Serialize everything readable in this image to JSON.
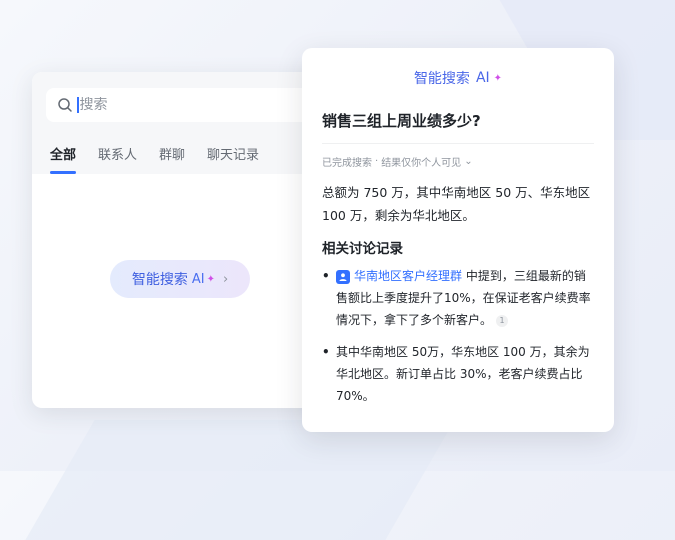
{
  "search_panel": {
    "placeholder": "搜索",
    "tabs": [
      {
        "label": "全部",
        "active": true
      },
      {
        "label": "联系人",
        "active": false
      },
      {
        "label": "群聊",
        "active": false
      },
      {
        "label": "聊天记录",
        "active": false
      }
    ],
    "ai_button": {
      "label": "智能搜索",
      "ai_tag": "AI",
      "sparkle": "✦",
      "chevron": "›"
    }
  },
  "result_card": {
    "header": {
      "label": "智能搜索",
      "ai_tag": "AI",
      "sparkle": "✦"
    },
    "question": "销售三组上周业绩多少?",
    "meta": {
      "status": "已完成搜索",
      "sep": "·",
      "visibility": "结果仅你个人可见",
      "chevron": "⌄"
    },
    "answer": "总额为 750 万，其中华南地区 50 万、华东地区 100 万，剩余为华北地区。",
    "related_title": "相关讨论记录",
    "bullets": [
      {
        "group_name": "华南地区客户经理群",
        "text": "中提到，三组最新的销售额比上季度提升了10%，在保证老客户续费率情况下，拿下了多个新客户。",
        "citation": "1"
      },
      {
        "text": "其中华南地区 50万，华东地区 100 万，其余为华北地区。新订单占比 30%，老客户续费占比 70%。"
      }
    ]
  },
  "colors": {
    "accent": "#3370ff",
    "ai_purple": "#d04fe8",
    "text_primary": "#1f2329",
    "text_secondary": "#8f959e"
  }
}
